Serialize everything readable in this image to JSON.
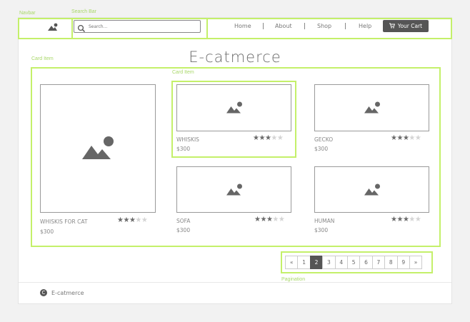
{
  "annotations": {
    "navbar": "Navbar",
    "search_bar": "Search Bar",
    "card_item_outer": "Card Item",
    "card_item_inner": "Card Item",
    "pagination": "Pagination"
  },
  "search": {
    "placeholder": "Search..."
  },
  "nav": {
    "links": [
      "Home",
      "About",
      "Shop",
      "Help"
    ],
    "cart_label": "Your Cart"
  },
  "page_title": "E-catmerce",
  "products": [
    {
      "name": "WHISKIS FOR CAT",
      "price": "$300",
      "rating": 3,
      "max_rating": 5
    },
    {
      "name": "WHISKIS",
      "price": "$300",
      "rating": 3,
      "max_rating": 5
    },
    {
      "name": "GECKO",
      "price": "$300",
      "rating": 3,
      "max_rating": 5
    },
    {
      "name": "SOFA",
      "price": "$300",
      "rating": 3,
      "max_rating": 5
    },
    {
      "name": "HUMAN",
      "price": "$300",
      "rating": 3,
      "max_rating": 5
    }
  ],
  "pagination": {
    "prev": "«",
    "pages": [
      "1",
      "2",
      "3",
      "4",
      "5",
      "6",
      "7",
      "8",
      "9"
    ],
    "active": "2",
    "next": "»"
  },
  "footer": {
    "copyright_symbol": "C",
    "brand": "E-catmerce"
  },
  "colors": {
    "annotation": "#c4f06a",
    "annotation_text": "#a9d86a",
    "dark": "#555555"
  }
}
